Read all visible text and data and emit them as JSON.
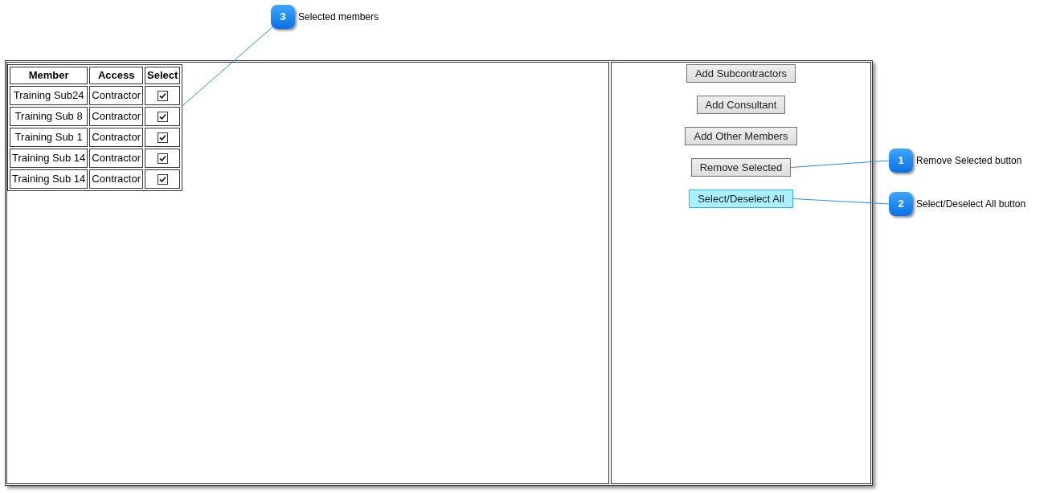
{
  "members_table": {
    "columns": [
      "Member",
      "Access",
      "Select"
    ],
    "rows": [
      {
        "member": "Training Sub24",
        "access": "Contractor",
        "checked": true
      },
      {
        "member": "Training Sub 8",
        "access": "Contractor",
        "checked": true
      },
      {
        "member": "Training Sub 1",
        "access": "Contractor",
        "checked": true
      },
      {
        "member": "Training Sub 14",
        "access": "Contractor",
        "checked": true
      },
      {
        "member": "Training Sub 14",
        "access": "Contractor",
        "checked": true
      }
    ],
    "callout": {
      "number": "3",
      "text": "Selected members"
    }
  },
  "buttons": [
    {
      "label": "Add Subcontractors",
      "highlighted": false
    },
    {
      "label": "Add Consultant",
      "highlighted": false
    },
    {
      "label": "Add Other Members",
      "highlighted": false
    },
    {
      "label": "Remove Selected",
      "highlighted": false,
      "callout": {
        "number": "1",
        "text": "Remove Selected button"
      }
    },
    {
      "label": "Select/Deselect All",
      "highlighted": true,
      "callout": {
        "number": "2",
        "text": "Select/Deselect All button"
      }
    }
  ]
}
